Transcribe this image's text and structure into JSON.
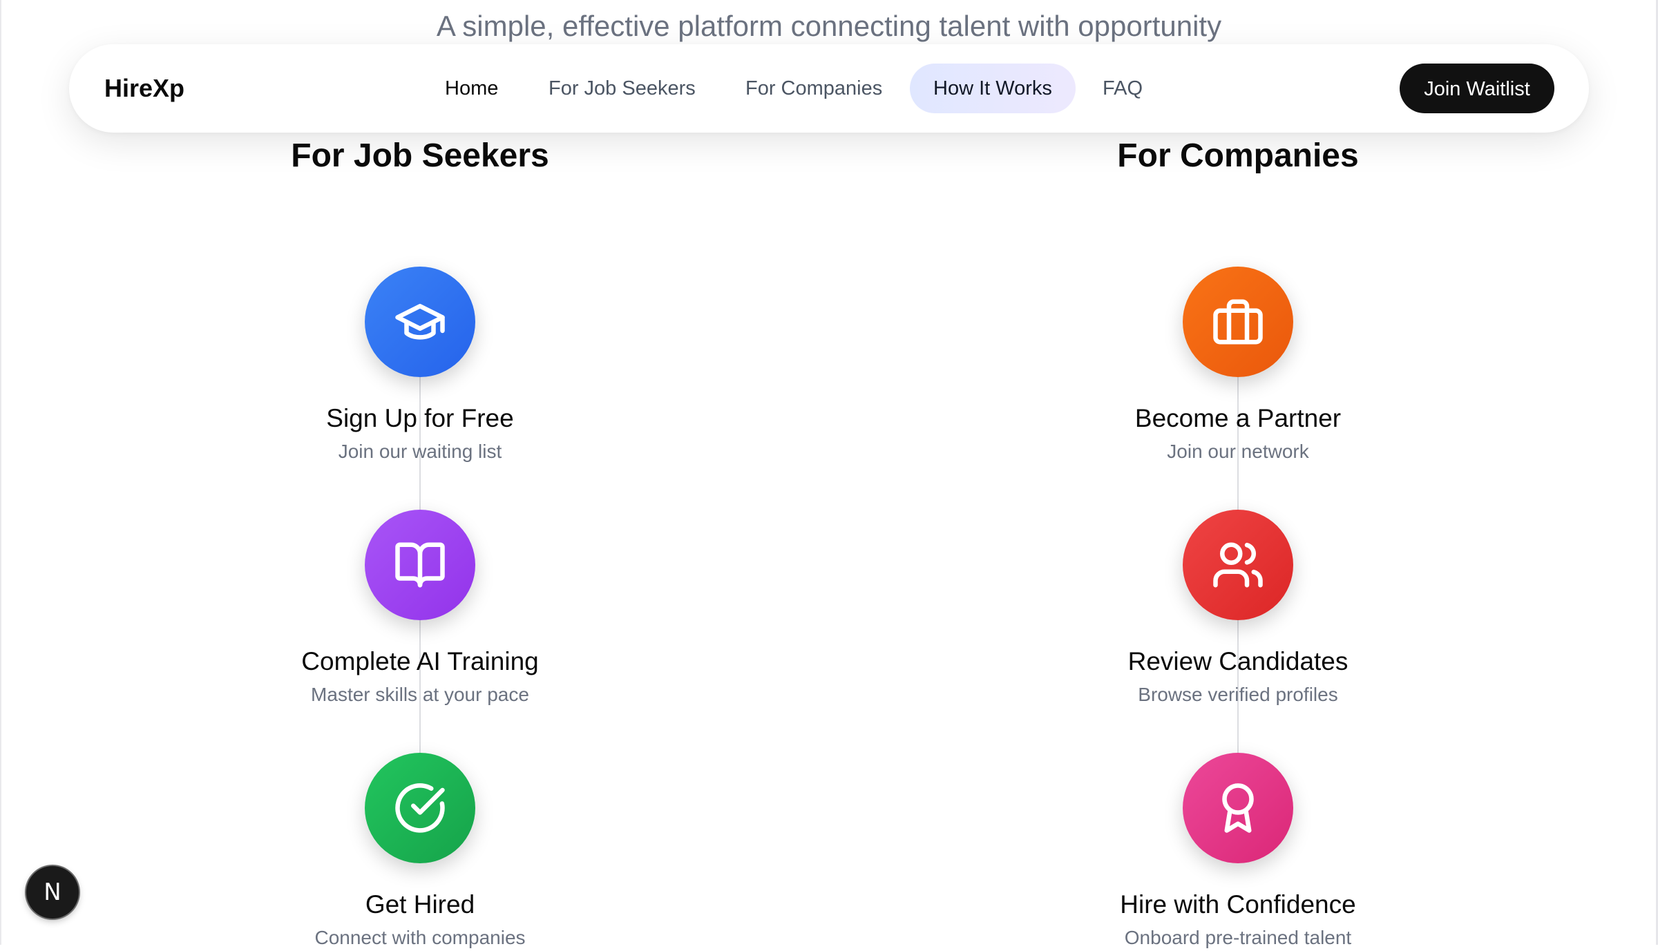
{
  "hero": {
    "subtitle": "A simple, effective platform connecting talent with opportunity"
  },
  "navbar": {
    "brand": "HireXp",
    "links": [
      {
        "label": "Home"
      },
      {
        "label": "For Job Seekers"
      },
      {
        "label": "For Companies"
      },
      {
        "label": "How It Works"
      },
      {
        "label": "FAQ"
      }
    ],
    "active_link": "How It Works",
    "cta_label": "Join Waitlist"
  },
  "job_seekers": {
    "title": "For Job Seekers",
    "steps": [
      {
        "title": "Sign Up for Free",
        "description": "Join our waiting list",
        "icon": "graduation-cap-icon",
        "color_from": "#3b82f6",
        "color_to": "#2563eb"
      },
      {
        "title": "Complete AI Training",
        "description": "Master skills at your pace",
        "icon": "open-book-icon",
        "color_from": "#a855f7",
        "color_to": "#9333ea"
      },
      {
        "title": "Get Hired",
        "description": "Connect with companies",
        "icon": "check-circle-icon",
        "color_from": "#22c55e",
        "color_to": "#16a34a"
      }
    ]
  },
  "companies": {
    "title": "For Companies",
    "steps": [
      {
        "title": "Become a Partner",
        "description": "Join our network",
        "icon": "briefcase-icon",
        "color_from": "#f97316",
        "color_to": "#ea580c"
      },
      {
        "title": "Review Candidates",
        "description": "Browse verified profiles",
        "icon": "users-icon",
        "color_from": "#ef4444",
        "color_to": "#dc2626"
      },
      {
        "title": "Hire with Confidence",
        "description": "Onboard pre-trained talent",
        "icon": "award-icon",
        "color_from": "#ec4899",
        "color_to": "#db2777"
      }
    ]
  },
  "dev_badge": {
    "letter": "N",
    "icon": "nextjs-icon"
  }
}
